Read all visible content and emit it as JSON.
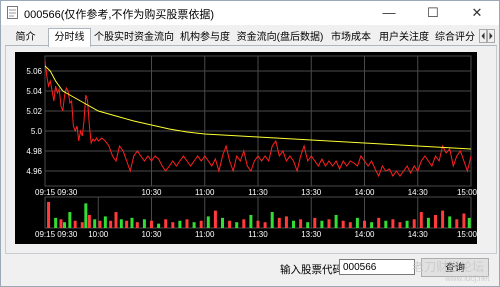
{
  "window": {
    "title": "000566(仅作参考,不作为购买股票依据)",
    "minimize_glyph": "—",
    "maximize_glyph": "☐",
    "close_glyph": "✕"
  },
  "tabs": [
    {
      "label": "简介"
    },
    {
      "label": "分时线"
    },
    {
      "label": "个股实时资金流向"
    },
    {
      "label": "机构参与度"
    },
    {
      "label": "资金流向(盘后数据)"
    },
    {
      "label": "市场成本"
    },
    {
      "label": "用户关注度"
    },
    {
      "label": "综合评分"
    }
  ],
  "active_tab_index": 1,
  "chart_data": {
    "type": "line",
    "title": "",
    "ylim": [
      4.945,
      5.075
    ],
    "y_ticks": [
      {
        "value": 5.06,
        "label": "5.06"
      },
      {
        "value": 5.04,
        "label": "5.04"
      },
      {
        "value": 5.02,
        "label": "5.02"
      },
      {
        "value": 5.0,
        "label": "5.0"
      },
      {
        "value": 4.98,
        "label": "4.98"
      },
      {
        "value": 4.96,
        "label": "4.96"
      }
    ],
    "x_ticks": [
      {
        "t": 0,
        "label": "09:15 09:30"
      },
      {
        "t": 60,
        "label": "10:30"
      },
      {
        "t": 90,
        "label": "11:00"
      },
      {
        "t": 120,
        "label": "11:30"
      },
      {
        "t": 150,
        "label": "13:30"
      },
      {
        "t": 180,
        "label": "14:00"
      },
      {
        "t": 210,
        "label": "14:30"
      },
      {
        "t": 240,
        "label": "15:00"
      }
    ],
    "x_ticks_volume": [
      {
        "t": 0,
        "label": "09:15 09:30"
      },
      {
        "t": 30,
        "label": "10:00"
      },
      {
        "t": 60,
        "label": "10:30"
      },
      {
        "t": 90,
        "label": "11:00"
      },
      {
        "t": 120,
        "label": "11:30"
      },
      {
        "t": 150,
        "label": "13:30"
      },
      {
        "t": 180,
        "label": "14:00"
      },
      {
        "t": 210,
        "label": "14:30"
      },
      {
        "t": 240,
        "label": "15:00"
      }
    ],
    "colors": {
      "background": "#000000",
      "grid": "#4a4a4a",
      "price": "#ff2020",
      "average": "#ffff30",
      "volume_up": "#ff3b3b",
      "volume_down": "#33dd33",
      "axis_text": "#ffffff"
    },
    "series": [
      {
        "name": "price",
        "points": [
          [
            0,
            5.07
          ],
          [
            1,
            5.055
          ],
          [
            2,
            5.045
          ],
          [
            3,
            5.05
          ],
          [
            4,
            5.04
          ],
          [
            5,
            5.03
          ],
          [
            6,
            5.045
          ],
          [
            7,
            5.038
          ],
          [
            8,
            5.042
          ],
          [
            9,
            5.025
          ],
          [
            10,
            5.02
          ],
          [
            11,
            5.035
          ],
          [
            12,
            5.043
          ],
          [
            13,
            5.04
          ],
          [
            14,
            5.028
          ],
          [
            15,
            5.03
          ],
          [
            16,
            5.005
          ],
          [
            17,
            5.0
          ],
          [
            18,
            5.005
          ],
          [
            19,
            4.99
          ],
          [
            20,
            5.0
          ],
          [
            21,
            4.995
          ],
          [
            22,
            5.01
          ],
          [
            23,
            5.036
          ],
          [
            24,
            5.03
          ],
          [
            25,
            5.005
          ],
          [
            26,
            4.988
          ],
          [
            27,
            4.992
          ],
          [
            28,
            4.99
          ],
          [
            29,
            4.993
          ],
          [
            30,
            4.99
          ],
          [
            32,
            4.993
          ],
          [
            34,
            4.99
          ],
          [
            36,
            4.985
          ],
          [
            38,
            4.975
          ],
          [
            40,
            4.97
          ],
          [
            42,
            4.985
          ],
          [
            44,
            4.98
          ],
          [
            46,
            4.97
          ],
          [
            48,
            4.96
          ],
          [
            50,
            4.975
          ],
          [
            52,
            4.98
          ],
          [
            54,
            4.975
          ],
          [
            56,
            4.97
          ],
          [
            58,
            4.975
          ],
          [
            60,
            4.97
          ],
          [
            62,
            4.975
          ],
          [
            64,
            4.972
          ],
          [
            66,
            4.965
          ],
          [
            68,
            4.96
          ],
          [
            70,
            4.965
          ],
          [
            72,
            4.97
          ],
          [
            74,
            4.965
          ],
          [
            76,
            4.97
          ],
          [
            78,
            4.975
          ],
          [
            80,
            4.97
          ],
          [
            82,
            4.965
          ],
          [
            84,
            4.97
          ],
          [
            86,
            4.975
          ],
          [
            88,
            4.97
          ],
          [
            90,
            4.975
          ],
          [
            92,
            4.97
          ],
          [
            94,
            4.965
          ],
          [
            96,
            4.972
          ],
          [
            98,
            4.96
          ],
          [
            100,
            4.975
          ],
          [
            102,
            4.985
          ],
          [
            104,
            4.97
          ],
          [
            106,
            4.96
          ],
          [
            108,
            4.975
          ],
          [
            110,
            4.97
          ],
          [
            112,
            4.98
          ],
          [
            114,
            4.965
          ],
          [
            116,
            4.96
          ],
          [
            118,
            4.97
          ],
          [
            120,
            4.975
          ],
          [
            122,
            4.97
          ],
          [
            124,
            4.975
          ],
          [
            126,
            4.97
          ],
          [
            128,
            4.985
          ],
          [
            130,
            4.99
          ],
          [
            132,
            4.975
          ],
          [
            134,
            4.98
          ],
          [
            136,
            4.97
          ],
          [
            138,
            4.975
          ],
          [
            140,
            4.97
          ],
          [
            142,
            4.96
          ],
          [
            144,
            4.975
          ],
          [
            146,
            4.985
          ],
          [
            148,
            4.97
          ],
          [
            150,
            4.975
          ],
          [
            152,
            4.97
          ],
          [
            154,
            4.965
          ],
          [
            156,
            4.972
          ],
          [
            158,
            4.965
          ],
          [
            160,
            4.97
          ],
          [
            162,
            4.965
          ],
          [
            164,
            4.97
          ],
          [
            166,
            4.962
          ],
          [
            168,
            4.97
          ],
          [
            170,
            4.965
          ],
          [
            172,
            4.97
          ],
          [
            174,
            4.968
          ],
          [
            176,
            4.965
          ],
          [
            178,
            4.975
          ],
          [
            180,
            4.97
          ],
          [
            182,
            4.965
          ],
          [
            184,
            4.97
          ],
          [
            186,
            4.962
          ],
          [
            188,
            4.955
          ],
          [
            190,
            4.965
          ],
          [
            192,
            4.96
          ],
          [
            194,
            4.962
          ],
          [
            196,
            4.955
          ],
          [
            198,
            4.96
          ],
          [
            200,
            4.955
          ],
          [
            202,
            4.96
          ],
          [
            204,
            4.965
          ],
          [
            206,
            4.958
          ],
          [
            208,
            4.965
          ],
          [
            210,
            4.96
          ],
          [
            212,
            4.97
          ],
          [
            214,
            4.975
          ],
          [
            216,
            4.97
          ],
          [
            218,
            4.965
          ],
          [
            220,
            4.975
          ],
          [
            222,
            4.97
          ],
          [
            224,
            4.985
          ],
          [
            226,
            4.978
          ],
          [
            228,
            4.982
          ],
          [
            230,
            4.965
          ],
          [
            232,
            4.975
          ],
          [
            234,
            4.98
          ],
          [
            236,
            4.97
          ],
          [
            238,
            4.96
          ],
          [
            240,
            4.975
          ]
        ]
      },
      {
        "name": "average",
        "points": [
          [
            0,
            5.065
          ],
          [
            3,
            5.06
          ],
          [
            6,
            5.05
          ],
          [
            10,
            5.04
          ],
          [
            15,
            5.035
          ],
          [
            20,
            5.03
          ],
          [
            30,
            5.02
          ],
          [
            40,
            5.015
          ],
          [
            50,
            5.01
          ],
          [
            60,
            5.006
          ],
          [
            70,
            5.002
          ],
          [
            80,
            4.999
          ],
          [
            90,
            4.997
          ],
          [
            100,
            4.996
          ],
          [
            110,
            4.995
          ],
          [
            120,
            4.994
          ],
          [
            130,
            4.993
          ],
          [
            140,
            4.992
          ],
          [
            150,
            4.991
          ],
          [
            160,
            4.99
          ],
          [
            170,
            4.989
          ],
          [
            180,
            4.988
          ],
          [
            190,
            4.987
          ],
          [
            200,
            4.986
          ],
          [
            210,
            4.985
          ],
          [
            220,
            4.984
          ],
          [
            230,
            4.983
          ],
          [
            240,
            4.982
          ]
        ]
      }
    ],
    "volume": [
      {
        "t": 2,
        "v": 0.9,
        "dir": "up"
      },
      {
        "t": 6,
        "v": 0.35,
        "dir": "down"
      },
      {
        "t": 9,
        "v": 0.3,
        "dir": "up"
      },
      {
        "t": 11,
        "v": 0.2,
        "dir": "down"
      },
      {
        "t": 14,
        "v": 0.55,
        "dir": "down"
      },
      {
        "t": 17,
        "v": 0.25,
        "dir": "up"
      },
      {
        "t": 21,
        "v": 0.2,
        "dir": "up"
      },
      {
        "t": 23,
        "v": 0.85,
        "dir": "down"
      },
      {
        "t": 25,
        "v": 0.45,
        "dir": "up"
      },
      {
        "t": 28,
        "v": 0.3,
        "dir": "down"
      },
      {
        "t": 31,
        "v": 0.25,
        "dir": "up"
      },
      {
        "t": 34,
        "v": 0.4,
        "dir": "down"
      },
      {
        "t": 37,
        "v": 0.25,
        "dir": "up"
      },
      {
        "t": 40,
        "v": 0.55,
        "dir": "up"
      },
      {
        "t": 43,
        "v": 0.3,
        "dir": "down"
      },
      {
        "t": 46,
        "v": 0.25,
        "dir": "up"
      },
      {
        "t": 49,
        "v": 0.35,
        "dir": "down"
      },
      {
        "t": 52,
        "v": 0.2,
        "dir": "up"
      },
      {
        "t": 56,
        "v": 0.3,
        "dir": "down"
      },
      {
        "t": 60,
        "v": 0.25,
        "dir": "up"
      },
      {
        "t": 64,
        "v": 0.15,
        "dir": "down"
      },
      {
        "t": 68,
        "v": 0.3,
        "dir": "up"
      },
      {
        "t": 72,
        "v": 0.2,
        "dir": "up"
      },
      {
        "t": 76,
        "v": 0.25,
        "dir": "down"
      },
      {
        "t": 80,
        "v": 0.3,
        "dir": "up"
      },
      {
        "t": 84,
        "v": 0.2,
        "dir": "down"
      },
      {
        "t": 88,
        "v": 0.25,
        "dir": "up"
      },
      {
        "t": 92,
        "v": 0.4,
        "dir": "down"
      },
      {
        "t": 96,
        "v": 0.6,
        "dir": "up"
      },
      {
        "t": 100,
        "v": 0.35,
        "dir": "down"
      },
      {
        "t": 104,
        "v": 0.25,
        "dir": "up"
      },
      {
        "t": 108,
        "v": 0.2,
        "dir": "down"
      },
      {
        "t": 112,
        "v": 0.3,
        "dir": "up"
      },
      {
        "t": 116,
        "v": 0.45,
        "dir": "down"
      },
      {
        "t": 120,
        "v": 0.25,
        "dir": "up"
      },
      {
        "t": 124,
        "v": 0.2,
        "dir": "up"
      },
      {
        "t": 128,
        "v": 0.55,
        "dir": "down"
      },
      {
        "t": 132,
        "v": 0.35,
        "dir": "up"
      },
      {
        "t": 136,
        "v": 0.4,
        "dir": "up"
      },
      {
        "t": 140,
        "v": 0.25,
        "dir": "down"
      },
      {
        "t": 144,
        "v": 0.3,
        "dir": "up"
      },
      {
        "t": 148,
        "v": 0.2,
        "dir": "down"
      },
      {
        "t": 152,
        "v": 0.35,
        "dir": "up"
      },
      {
        "t": 156,
        "v": 0.25,
        "dir": "down"
      },
      {
        "t": 160,
        "v": 0.3,
        "dir": "up"
      },
      {
        "t": 164,
        "v": 0.45,
        "dir": "down"
      },
      {
        "t": 168,
        "v": 0.25,
        "dir": "up"
      },
      {
        "t": 172,
        "v": 0.2,
        "dir": "up"
      },
      {
        "t": 176,
        "v": 0.35,
        "dir": "down"
      },
      {
        "t": 180,
        "v": 0.25,
        "dir": "up"
      },
      {
        "t": 184,
        "v": 0.2,
        "dir": "down"
      },
      {
        "t": 188,
        "v": 0.35,
        "dir": "up"
      },
      {
        "t": 192,
        "v": 0.25,
        "dir": "down"
      },
      {
        "t": 196,
        "v": 0.3,
        "dir": "up"
      },
      {
        "t": 200,
        "v": 0.2,
        "dir": "up"
      },
      {
        "t": 204,
        "v": 0.25,
        "dir": "down"
      },
      {
        "t": 208,
        "v": 0.3,
        "dir": "up"
      },
      {
        "t": 212,
        "v": 0.55,
        "dir": "up"
      },
      {
        "t": 216,
        "v": 0.35,
        "dir": "down"
      },
      {
        "t": 220,
        "v": 0.45,
        "dir": "up"
      },
      {
        "t": 224,
        "v": 0.6,
        "dir": "up"
      },
      {
        "t": 228,
        "v": 0.4,
        "dir": "down"
      },
      {
        "t": 232,
        "v": 0.3,
        "dir": "up"
      },
      {
        "t": 236,
        "v": 0.5,
        "dir": "up"
      },
      {
        "t": 239,
        "v": 0.35,
        "dir": "down"
      }
    ]
  },
  "search": {
    "label": "输入股票代码:",
    "value": "000566",
    "button_label": "查询"
  },
  "watermark": {
    "text": "老刀财经论坛",
    "subtext": "www.ldcj.net"
  }
}
